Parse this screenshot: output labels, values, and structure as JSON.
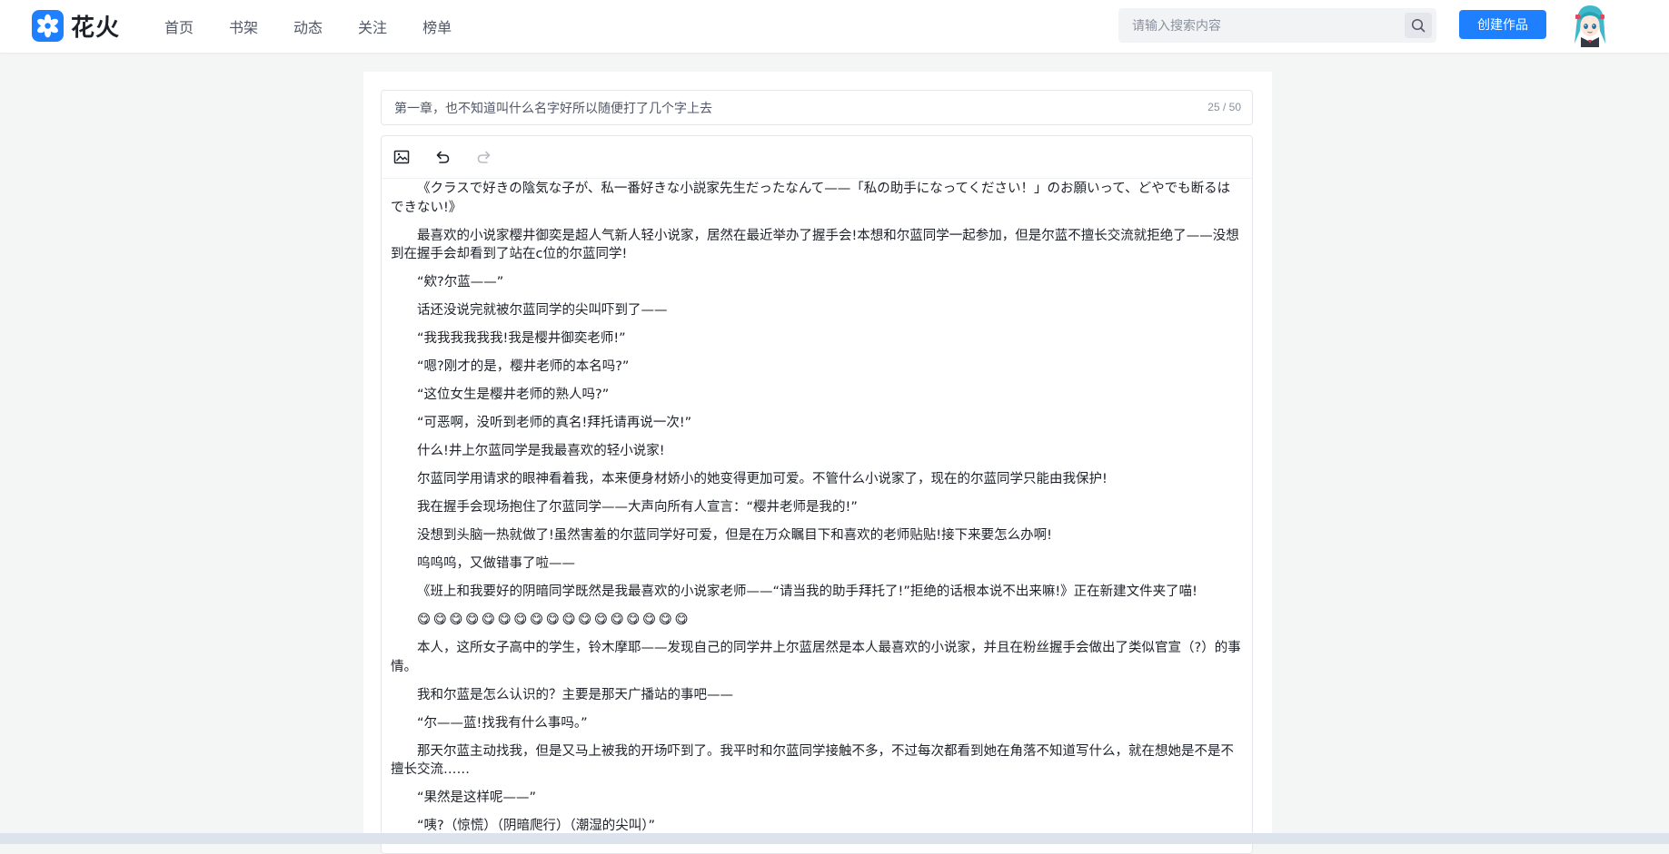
{
  "header": {
    "logo_text": "花火",
    "nav": [
      "首页",
      "书架",
      "动态",
      "关注",
      "榜单"
    ],
    "search_placeholder": "请输入搜索内容",
    "create_button": "创建作品"
  },
  "editor": {
    "title_value": "第一章，也不知道叫什么名字好所以随便打了几个字上去",
    "title_count": "25 / 50",
    "toolbar_icons": [
      "image-icon",
      "undo-icon",
      "redo-icon"
    ],
    "paragraphs": [
      "《クラスで好きの陰気な子が、私一番好きな小説家先生だったなんて——「私の助手になってください！」のお願いって、どやでも断るはできない!》",
      "最喜欢的小说家樱井御奕是超人气新人轻小说家，居然在最近举办了握手会!本想和尔蓝同学一起参加，但是尔蓝不擅长交流就拒绝了——没想到在握手会却看到了站在c位的尔蓝同学!",
      "“欸?尔蓝——”",
      "话还没说完就被尔蓝同学的尖叫吓到了——",
      "“我我我我我我!我是樱井御奕老师!”",
      "“嗯?刚才的是，樱井老师的本名吗?”",
      "“这位女生是樱井老师的熟人吗?”",
      "“可恶啊，没听到老师的真名!拜托请再说一次!”",
      "什么!井上尔蓝同学是我最喜欢的轻小说家!",
      "尔蓝同学用请求的眼神看着我，本来便身材娇小的她变得更加可爱。不管什么小说家了，现在的尔蓝同学只能由我保护!",
      "我在握手会现场抱住了尔蓝同学——大声向所有人宣言：“樱井老师是我的!”",
      "没想到头脑一热就做了!虽然害羞的尔蓝同学好可爱，但是在万众瞩目下和喜欢的老师贴贴!接下来要怎么办啊!",
      "呜呜呜，又做错事了啦——",
      "《班上和我要好的阴暗同学既然是我最喜欢的小说家老师——“请当我的助手拜托了!”拒绝的话根本说不出来嘛!》正在新建文件夹了喵!",
      "😋😋😋😋😋😋😋😋😋😋😋😋😋😋😋😋😋",
      "本人，这所女子高中的学生，铃木摩耶——发现自己的同学井上尔蓝居然是本人最喜欢的小说家，并且在粉丝握手会做出了类似官宣（?）的事情。",
      "我和尔蓝是怎么认识的？主要是那天广播站的事吧——",
      "“尔——蓝!找我有什么事吗。”",
      "那天尔蓝主动找我，但是又马上被我的开场吓到了。我平时和尔蓝同学接触不多，不过每次都看到她在角落不知道写什么，就在想她是不是不擅长交流……",
      "“果然是这样呢——”",
      "“咦?（惊慌）（阴暗爬行）（潮湿的尖叫）”"
    ]
  },
  "colors": {
    "accent": "#1e80ff",
    "background": "#f4f5f5",
    "text": "#1d2129"
  }
}
